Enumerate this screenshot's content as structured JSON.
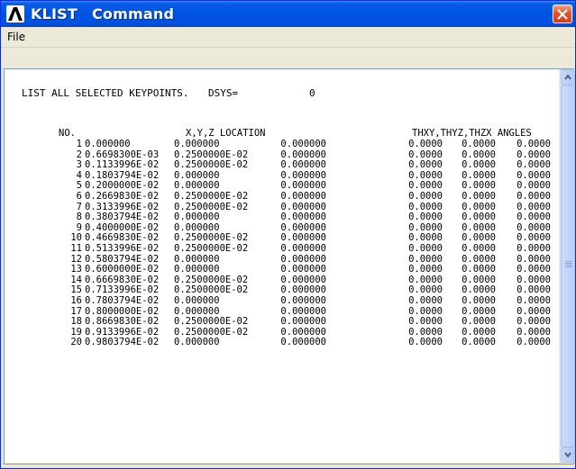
{
  "window": {
    "app_name": "KLIST",
    "subtitle": "Command",
    "colors": {
      "titlebar": "#0054E3",
      "close": "#D73B16",
      "background": "#ECE9D8"
    }
  },
  "menu": {
    "file_label": "File"
  },
  "listing": {
    "header": "LIST ALL SELECTED KEYPOINTS.",
    "dsys_label": "DSYS=",
    "dsys_value": "0",
    "columns": {
      "no": "NO.",
      "location": "X,Y,Z LOCATION",
      "angles": "THXY,THYZ,THZX ANGLES"
    },
    "rows": [
      {
        "no": "1",
        "x": "0.000000",
        "y": "0.000000",
        "z": "0.000000",
        "a1": "0.0000",
        "a2": "0.0000",
        "a3": "0.0000"
      },
      {
        "no": "2",
        "x": "0.6698300E-03",
        "y": "0.2500000E-02",
        "z": "0.000000",
        "a1": "0.0000",
        "a2": "0.0000",
        "a3": "0.0000"
      },
      {
        "no": "3",
        "x": "0.1133996E-02",
        "y": "0.2500000E-02",
        "z": "0.000000",
        "a1": "0.0000",
        "a2": "0.0000",
        "a3": "0.0000"
      },
      {
        "no": "4",
        "x": "0.1803794E-02",
        "y": "0.000000",
        "z": "0.000000",
        "a1": "0.0000",
        "a2": "0.0000",
        "a3": "0.0000"
      },
      {
        "no": "5",
        "x": "0.2000000E-02",
        "y": "0.000000",
        "z": "0.000000",
        "a1": "0.0000",
        "a2": "0.0000",
        "a3": "0.0000"
      },
      {
        "no": "6",
        "x": "0.2669830E-02",
        "y": "0.2500000E-02",
        "z": "0.000000",
        "a1": "0.0000",
        "a2": "0.0000",
        "a3": "0.0000"
      },
      {
        "no": "7",
        "x": "0.3133996E-02",
        "y": "0.2500000E-02",
        "z": "0.000000",
        "a1": "0.0000",
        "a2": "0.0000",
        "a3": "0.0000"
      },
      {
        "no": "8",
        "x": "0.3803794E-02",
        "y": "0.000000",
        "z": "0.000000",
        "a1": "0.0000",
        "a2": "0.0000",
        "a3": "0.0000"
      },
      {
        "no": "9",
        "x": "0.4000000E-02",
        "y": "0.000000",
        "z": "0.000000",
        "a1": "0.0000",
        "a2": "0.0000",
        "a3": "0.0000"
      },
      {
        "no": "10",
        "x": "0.4669830E-02",
        "y": "0.2500000E-02",
        "z": "0.000000",
        "a1": "0.0000",
        "a2": "0.0000",
        "a3": "0.0000"
      },
      {
        "no": "11",
        "x": "0.5133996E-02",
        "y": "0.2500000E-02",
        "z": "0.000000",
        "a1": "0.0000",
        "a2": "0.0000",
        "a3": "0.0000"
      },
      {
        "no": "12",
        "x": "0.5803794E-02",
        "y": "0.000000",
        "z": "0.000000",
        "a1": "0.0000",
        "a2": "0.0000",
        "a3": "0.0000"
      },
      {
        "no": "13",
        "x": "0.6000000E-02",
        "y": "0.000000",
        "z": "0.000000",
        "a1": "0.0000",
        "a2": "0.0000",
        "a3": "0.0000"
      },
      {
        "no": "14",
        "x": "0.6669830E-02",
        "y": "0.2500000E-02",
        "z": "0.000000",
        "a1": "0.0000",
        "a2": "0.0000",
        "a3": "0.0000"
      },
      {
        "no": "15",
        "x": "0.7133996E-02",
        "y": "0.2500000E-02",
        "z": "0.000000",
        "a1": "0.0000",
        "a2": "0.0000",
        "a3": "0.0000"
      },
      {
        "no": "16",
        "x": "0.7803794E-02",
        "y": "0.000000",
        "z": "0.000000",
        "a1": "0.0000",
        "a2": "0.0000",
        "a3": "0.0000"
      },
      {
        "no": "17",
        "x": "0.8000000E-02",
        "y": "0.000000",
        "z": "0.000000",
        "a1": "0.0000",
        "a2": "0.0000",
        "a3": "0.0000"
      },
      {
        "no": "18",
        "x": "0.8669830E-02",
        "y": "0.2500000E-02",
        "z": "0.000000",
        "a1": "0.0000",
        "a2": "0.0000",
        "a3": "0.0000"
      },
      {
        "no": "19",
        "x": "0.9133996E-02",
        "y": "0.2500000E-02",
        "z": "0.000000",
        "a1": "0.0000",
        "a2": "0.0000",
        "a3": "0.0000"
      },
      {
        "no": "20",
        "x": "0.9803794E-02",
        "y": "0.000000",
        "z": "0.000000",
        "a1": "0.0000",
        "a2": "0.0000",
        "a3": "0.0000"
      }
    ]
  },
  "icons": {
    "app": "ansys-logo-icon",
    "close": "close-icon",
    "scroll_up": "scroll-up-arrow-icon",
    "scroll_down": "scroll-down-arrow-icon"
  }
}
